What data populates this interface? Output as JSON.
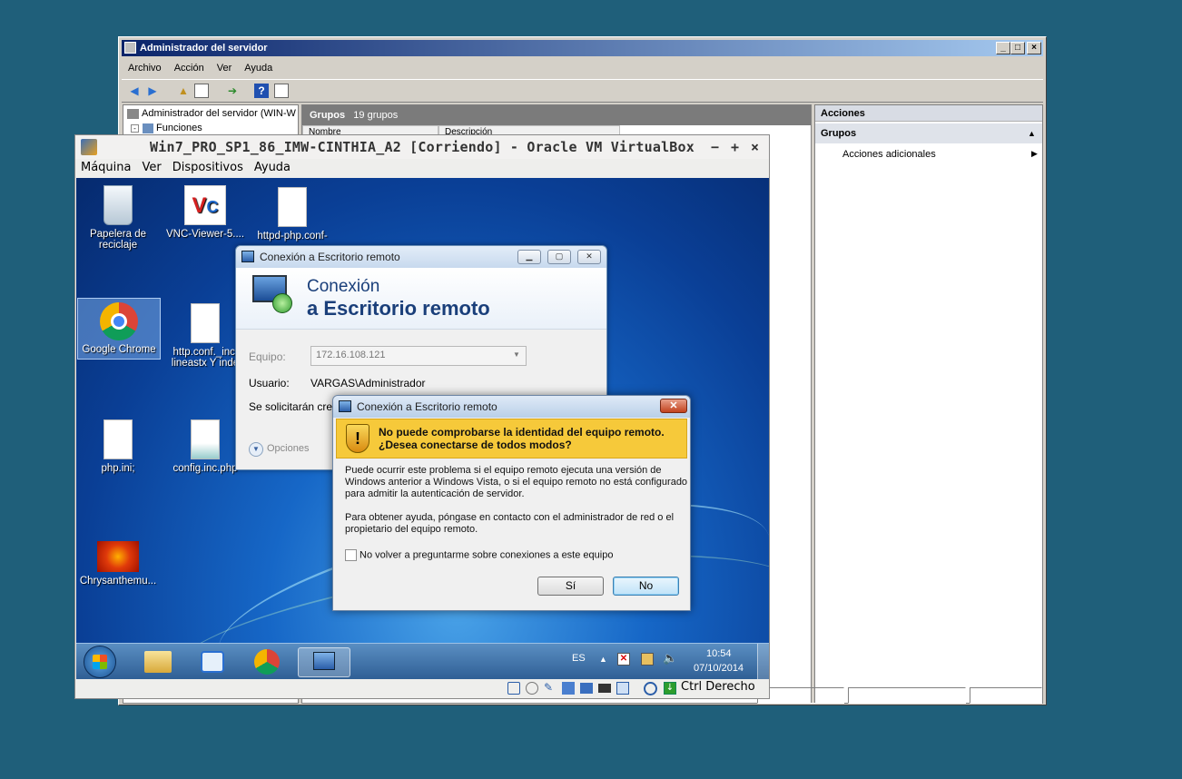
{
  "server_manager": {
    "title": "Administrador del servidor",
    "menu": [
      "Archivo",
      "Acción",
      "Ver",
      "Ayuda"
    ],
    "tree_root": "Administrador del servidor (WIN-W",
    "tree_child": "Funciones",
    "center_header": "Grupos",
    "center_count": "19 grupos",
    "col1": "Nombre",
    "col2": "Descripción",
    "actions_header": "Acciones",
    "actions_group": "Grupos",
    "actions_item": "Acciones adicionales"
  },
  "virtualbox": {
    "title": "Win7_PRO_SP1_86_IMW-CINTHIA_A2 [Corriendo] - Oracle VM VirtualBox",
    "menu": [
      "Máquina",
      "Ver",
      "Dispositivos",
      "Ayuda"
    ],
    "host_key": "Ctrl Derecho"
  },
  "desktop": {
    "icons": {
      "recycle": "Papelera de reciclaje",
      "vnc": "VNC-Viewer-5....",
      "httpd": "httpd-php.conf-",
      "chrome": "Google Chrome",
      "httpconf": "http.conf._incl lineastx Y inde",
      "phpini": "php.ini;",
      "configinc": "config.inc.php",
      "chrysanthemum": "Chrysanthemu..."
    },
    "taskbar": {
      "lang": "ES",
      "time": "10:54",
      "date": "07/10/2014"
    }
  },
  "rdp_dialog": {
    "title": "Conexión a Escritorio remoto",
    "heading1": "Conexión",
    "heading2": "a Escritorio remoto",
    "equipo_label": "Equipo:",
    "equipo_value": "172.16.108.121",
    "usuario_label": "Usuario:",
    "usuario_value": "VARGAS\\Administrador",
    "info": "Se solicitarán crede",
    "options": "Opciones"
  },
  "warning_dialog": {
    "title": "Conexión a Escritorio remoto",
    "headline1": "No puede comprobarse la identidad del equipo remoto.",
    "headline2": "¿Desea conectarse de todos modos?",
    "para1a": "Puede ocurrir este problema si el equipo remoto ejecuta una versión de",
    "para1b": "Windows anterior a Windows Vista, o si el equipo remoto no está configurado",
    "para1c": "para admitir la autenticación de servidor.",
    "para2a": "Para obtener ayuda, póngase en contacto con el administrador de red o el",
    "para2b": "propietario del equipo remoto.",
    "checkbox": "No volver a preguntarme sobre conexiones a este equipo",
    "yes": "Sí",
    "no": "No"
  }
}
